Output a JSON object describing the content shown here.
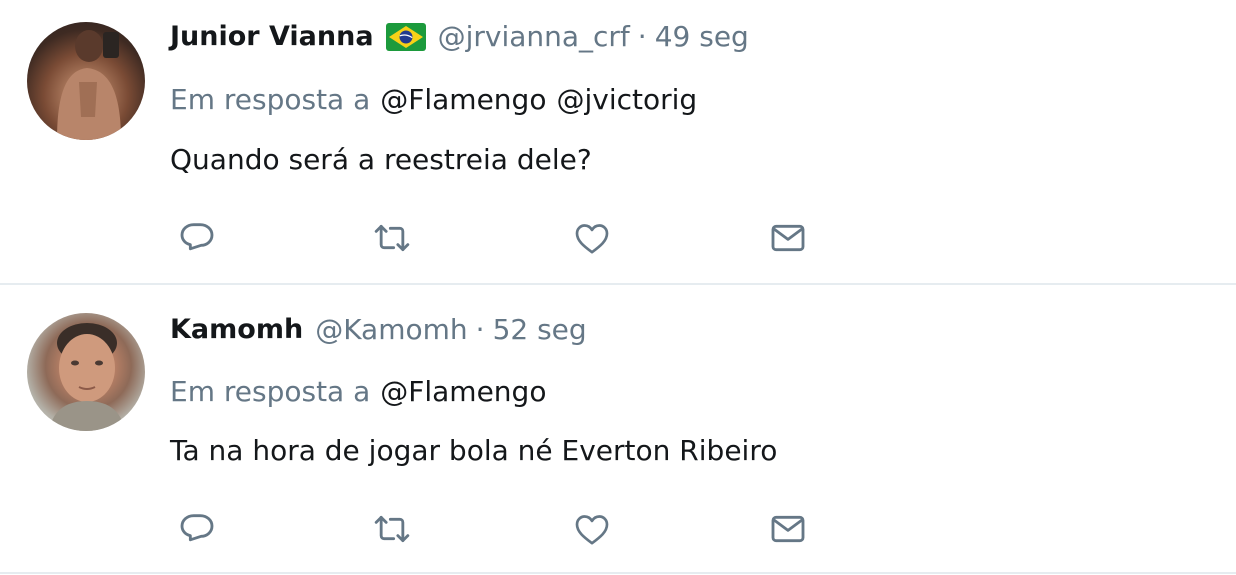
{
  "tweets": [
    {
      "name": "Junior Vianna",
      "has_flag": true,
      "flag_icon": "brazil-flag-icon",
      "handle": "@jrvianna_crf",
      "separator": "·",
      "time": "49 seg",
      "reply_label": "Em resposta a",
      "reply_mentions": [
        "@Flamengo",
        "@jvictorig"
      ],
      "text": "Quando será a reestreia dele?"
    },
    {
      "name": "Kamomh",
      "has_flag": false,
      "handle": "@Kamomh",
      "separator": "·",
      "time": "52 seg",
      "reply_label": "Em resposta a",
      "reply_mentions": [
        "@Flamengo"
      ],
      "text": "Ta na hora de jogar bola né Everton Ribeiro"
    }
  ],
  "actions": [
    "reply-icon",
    "retweet-icon",
    "like-icon",
    "direct-message-icon"
  ],
  "colors": {
    "text": "#14171a",
    "secondary": "#657786",
    "divider": "#e6ecf0",
    "icon": "#657786"
  }
}
